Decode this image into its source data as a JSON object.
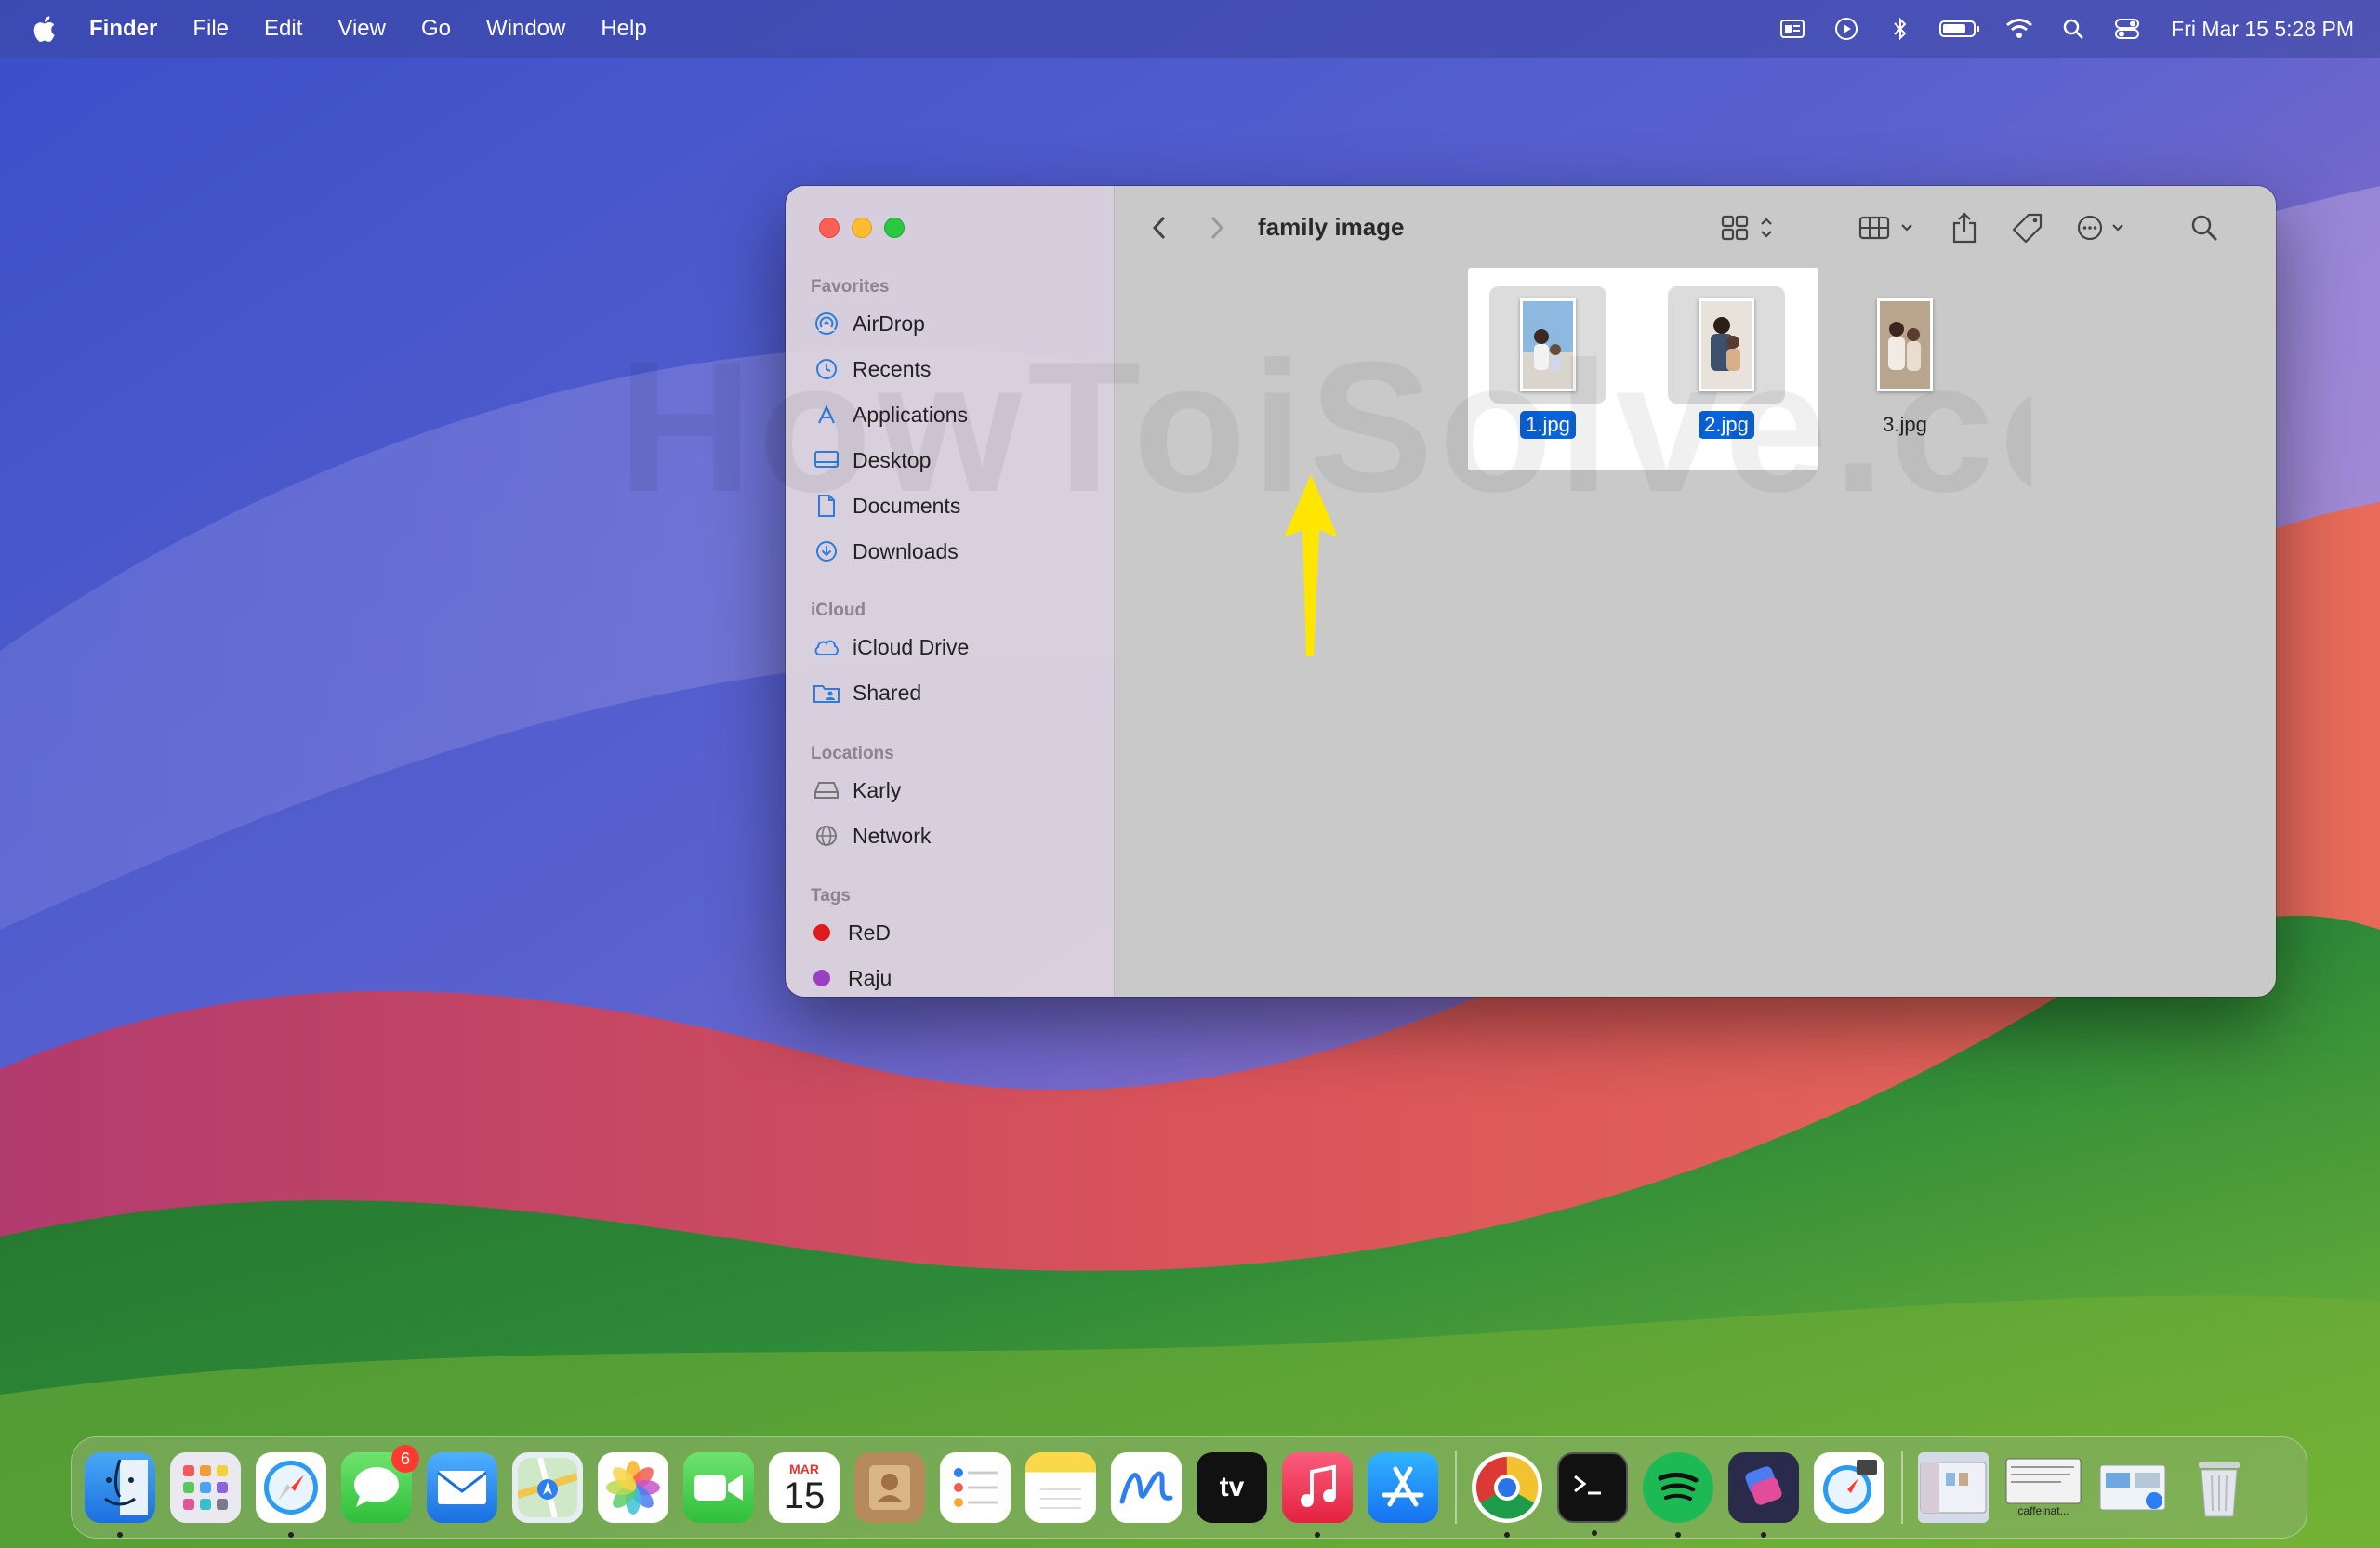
{
  "menubar": {
    "app_name": "Finder",
    "items": [
      "File",
      "Edit",
      "View",
      "Go",
      "Window",
      "Help"
    ],
    "clock": "Fri Mar 15  5:28 PM"
  },
  "finder": {
    "title": "family image",
    "sidebar": {
      "favorites_label": "Favorites",
      "favorites": [
        {
          "label": "AirDrop",
          "icon": "airdrop-icon"
        },
        {
          "label": "Recents",
          "icon": "clock-icon"
        },
        {
          "label": "Applications",
          "icon": "applications-icon"
        },
        {
          "label": "Desktop",
          "icon": "desktop-icon"
        },
        {
          "label": "Documents",
          "icon": "document-icon"
        },
        {
          "label": "Downloads",
          "icon": "download-icon"
        }
      ],
      "icloud_label": "iCloud",
      "icloud": [
        {
          "label": "iCloud Drive",
          "icon": "cloud-icon"
        },
        {
          "label": "Shared",
          "icon": "shared-folder-icon"
        }
      ],
      "locations_label": "Locations",
      "locations": [
        {
          "label": "Karly",
          "icon": "drive-icon"
        },
        {
          "label": "Network",
          "icon": "globe-icon"
        }
      ],
      "tags_label": "Tags",
      "tags": [
        {
          "label": "ReD",
          "color": "#e0191c"
        },
        {
          "label": "Raju",
          "color": "#9b3fc4"
        }
      ]
    },
    "files": [
      {
        "name": "1.jpg",
        "selected": true
      },
      {
        "name": "2.jpg",
        "selected": true
      },
      {
        "name": "3.jpg",
        "selected": false
      }
    ]
  },
  "watermark": "HowToiSolve.com",
  "dock": {
    "calendar_month": "MAR",
    "calendar_day": "15",
    "messages_badge": "6",
    "tv_label": "tv",
    "caffeinate_label": "caffeinat..."
  },
  "colors": {
    "selection_blue": "#0a63d8",
    "arrow_yellow": "#ffe600"
  }
}
